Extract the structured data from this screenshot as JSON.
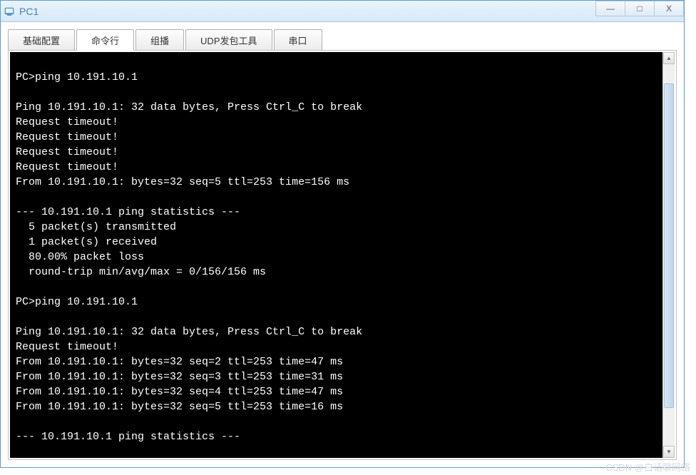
{
  "window": {
    "title": "PC1"
  },
  "controls": {
    "minimize": "—",
    "maximize": "□",
    "close": "X"
  },
  "tabs": {
    "items": [
      {
        "label": "基础配置",
        "active": false
      },
      {
        "label": "命令行",
        "active": true
      },
      {
        "label": "组播",
        "active": false
      },
      {
        "label": "UDP发包工具",
        "active": false
      },
      {
        "label": "串口",
        "active": false
      }
    ]
  },
  "terminal": {
    "lines": [
      "",
      "PC>ping 10.191.10.1",
      "",
      "Ping 10.191.10.1: 32 data bytes, Press Ctrl_C to break",
      "Request timeout!",
      "Request timeout!",
      "Request timeout!",
      "Request timeout!",
      "From 10.191.10.1: bytes=32 seq=5 ttl=253 time=156 ms",
      "",
      "--- 10.191.10.1 ping statistics ---",
      "  5 packet(s) transmitted",
      "  1 packet(s) received",
      "  80.00% packet loss",
      "  round-trip min/avg/max = 0/156/156 ms",
      "",
      "PC>ping 10.191.10.1",
      "",
      "Ping 10.191.10.1: 32 data bytes, Press Ctrl_C to break",
      "Request timeout!",
      "From 10.191.10.1: bytes=32 seq=2 ttl=253 time=47 ms",
      "From 10.191.10.1: bytes=32 seq=3 ttl=253 time=31 ms",
      "From 10.191.10.1: bytes=32 seq=4 ttl=253 time=47 ms",
      "From 10.191.10.1: bytes=32 seq=5 ttl=253 time=16 ms",
      "",
      "--- 10.191.10.1 ping statistics ---"
    ]
  },
  "watermark": "CSDN @白话聊网络"
}
